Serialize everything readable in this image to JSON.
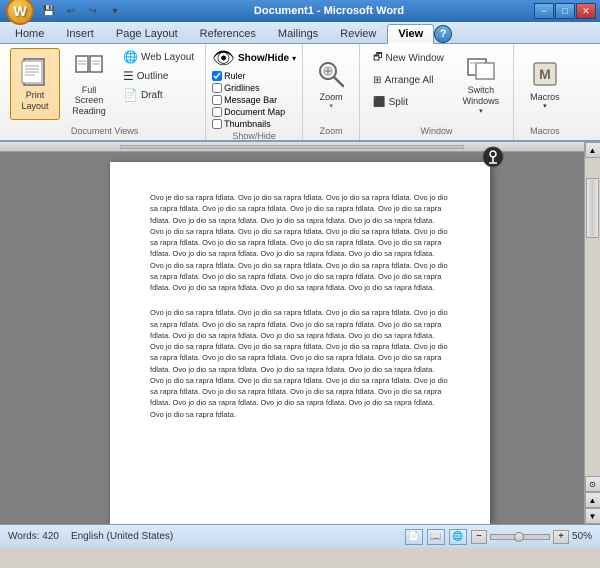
{
  "titleBar": {
    "title": "Document1 - Microsoft Word",
    "minimizeLabel": "−",
    "restoreLabel": "□",
    "closeLabel": "✕"
  },
  "quickAccess": {
    "saveLabel": "💾",
    "undoLabel": "↩",
    "redoLabel": "↪",
    "dropLabel": "▾"
  },
  "tabs": [
    {
      "label": "Home",
      "active": false
    },
    {
      "label": "Insert",
      "active": false
    },
    {
      "label": "Page Layout",
      "active": false
    },
    {
      "label": "References",
      "active": false
    },
    {
      "label": "Mailings",
      "active": false
    },
    {
      "label": "Review",
      "active": false
    },
    {
      "label": "View",
      "active": true
    }
  ],
  "ribbon": {
    "groups": {
      "documentViews": {
        "label": "Document Views",
        "buttons": [
          {
            "id": "print-layout",
            "label": "Print\nLayout",
            "active": true
          },
          {
            "id": "full-screen-reading",
            "label": "Full Screen\nReading",
            "active": false
          },
          {
            "id": "web-layout",
            "label": "Web Layout",
            "active": false
          },
          {
            "id": "outline",
            "label": "Outline",
            "active": false
          },
          {
            "id": "draft",
            "label": "Draft",
            "active": false
          }
        ]
      },
      "showHide": {
        "label": "Show/Hide",
        "bigLabel": "Show/Hide",
        "items": [
          "Ruler",
          "Gridlines",
          "Message Bar",
          "Document Map",
          "Thumbnails"
        ]
      },
      "zoom": {
        "label": "Zoom",
        "mainLabel": "Zoom"
      },
      "window": {
        "label": "Window",
        "items": [
          "New Window",
          "Arrange All",
          "Split"
        ],
        "switchLabel": "Switch\nWindows"
      },
      "macros": {
        "label": "Macros",
        "mainLabel": "Macros"
      }
    }
  },
  "document": {
    "paragraph1": "Ovo je dio sa rapra fdlata. Ovo jo dio sa rapra fdlata. Ovo jo dio sa rapra fdlata. Ovo jo dio sa rapra fdlata. Ovo jo dio sa rapra fdlata. Ovo jo dio sa rapra fdlata. Ovo jo dio sa rapra fdlata. Ovo jo dio sa rapra fdlata. Ovo jo dio sa rapra fdlata. Ovo jo dio sa rapra fdlata. Ovo jo dio sa rapra fdlata. Ovo jo dio sa rapra fdlata. Ovo jo dio sa rapra fdlata. Ovo jo dio sa rapra fdlata. Ovo jo dio sa rapra fdlata. Ovo jo dio sa rapra fdlata. Ovo jo dio sa rapra fdlata. Ovo jo dio sa rapra fdlata. Ovo jo dio sa rapra fdlata. Ovo jo dio sa rapra fdlata. Ovo jo dio sa rapra fdlata. Ovo jo dio sa rapra fdlata. Ovo jo dio sa rapra fdlata. Ovo jo dio sa rapra fdlata. Ovo jo dio sa rapra fdlata. Ovo jo dio sa rapra fdlata. Ovo jo dio sa rapra fdlata. Ovo jo dio sa rapra fdlata. Ovo jo dio sa rapra fdlata. Ovo jo dio sa rapra fdlata.",
    "paragraph2": "Ovo jo dio sa rapra fdlata. Ovo jo dio sa rapra fdlata. Ovo jo dio sa rapra fdlata. Ovo jo dio sa rapra fdlata. Ovo jo dio sa rapra fdlata. Ovo jo dio sa rapra fdlata. Ovo jo dio sa rapra fdlata. Ovo jo dio sa rapra fdlata. Ovo jo dio sa rapra fdlata. Ovo jo dio sa rapra fdlata. Ovo jo dio sa rapra fdlata. Ovo jo dio sa rapra fdlata. Ovo jo dio sa rapra fdlata. Ovo jo dio sa rapra fdlata. Ovo jo dio sa rapra fdlata. Ovo jo dio sa rapra fdlata. Ovo jo dio sa rapra fdlata. Ovo jo dio sa rapra fdlata. Ovo jo dio sa rapra fdlata. Ovo jo dio sa rapra fdlata. Ovo jo dio sa rapra fdlata. Ovo jo dio sa rapra fdlata. Ovo jo dio sa rapra fdlata. Ovo jo dio sa rapra fdlata. Ovo jo dio sa rapra fdlata. Ovo jo dio sa rapra fdlata. Ovo jo dio sa rapra fdlata. Ovo jo dio sa rapra fdlata. Ovo jo dio sa rapra fdlata. Ovo jo dio sa rapra fdlata. Ovo jo dio sa rapra fdlata."
  },
  "statusBar": {
    "words": "Words: 420",
    "language": "English (United States)",
    "zoomLevel": "50%",
    "zoomMinus": "−",
    "zoomPlus": "+"
  }
}
